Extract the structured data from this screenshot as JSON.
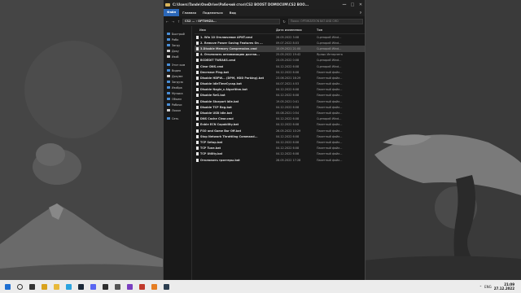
{
  "window": {
    "title": "C:\\Users\\Tande\\OneDrive\\Рабочий стол\\CS2 BOOST DOMOCUM\\CS2 BOO...",
    "controls": [
      "—",
      "□",
      "✕"
    ]
  },
  "menu": [
    "Файл",
    "Главная",
    "Поделиться",
    "Вид"
  ],
  "address": {
    "path": "CS2 ... › OPTIMIZA...",
    "search_placeholder": "Поиск: OPTIMIZATION BAT AND CMD"
  },
  "sidebar": [
    {
      "label": "Быстрый",
      "icon": "star-icon",
      "color": "#4a8fd8"
    },
    {
      "label": "Рабо",
      "icon": "desktop-icon",
      "color": "#4a8fd8"
    },
    {
      "label": "Загру",
      "icon": "download-icon",
      "color": "#4a8fd8"
    },
    {
      "label": "Доку",
      "icon": "document-icon",
      "color": "#cfcfcf"
    },
    {
      "label": "Изоб",
      "icon": "pictures-icon",
      "color": "#cfcfcf"
    },
    {
      "label": "Этот ком",
      "icon": "computer-icon",
      "color": "#4a8fd8"
    },
    {
      "label": "Видео",
      "icon": "video-icon",
      "color": "#4a8fd8"
    },
    {
      "label": "Докуме",
      "icon": "document-icon",
      "color": "#cfcfcf"
    },
    {
      "label": "Загрузк",
      "icon": "download-icon",
      "color": "#4a8fd8"
    },
    {
      "label": "Изобра",
      "icon": "pictures-icon",
      "color": "#4a8fd8"
    },
    {
      "label": "Музыка",
      "icon": "music-icon",
      "color": "#4a8fd8"
    },
    {
      "label": "Объем",
      "icon": "objects-icon",
      "color": "#4a8fd8"
    },
    {
      "label": "Рабочи",
      "icon": "desktop-icon",
      "color": "#4a8fd8"
    },
    {
      "label": "Локал",
      "icon": "drive-icon",
      "color": "#cfcfcf"
    },
    {
      "label": "Сеть",
      "icon": "network-icon",
      "color": "#4a8fd8"
    }
  ],
  "columns": {
    "name": "Имя",
    "date": "Дата изменения",
    "type": "Тип"
  },
  "files": [
    {
      "name": "1. Win 10 Отключение APNT.cmd",
      "date": "26.05.2022 3:08",
      "type": "Сценарий Wind..."
    },
    {
      "name": "2. Remove Power Saving Features On ...",
      "date": "09.07.2022 8:03",
      "type": "Сценарий Wind..."
    },
    {
      "name": "3.Disable Memory Compression.cmd",
      "date": "15.09.2021 21:00",
      "type": "Сценарий Wind..."
    },
    {
      "name": "4. Отключить оптимизацию достав...",
      "date": "25.05.2022 19:42",
      "type": "Ярлык Интернета"
    },
    {
      "name": "BCDEDIT TWEAKS.cmd",
      "date": "23.05.2022 0:08",
      "type": "Сценарий Wind..."
    },
    {
      "name": "Clear DNS.cmd",
      "date": "04.12.2022 6:08",
      "type": "Сценарий Wind..."
    },
    {
      "name": "Decrease Ping.bat",
      "date": "04.12.2022 6:08",
      "type": "Пакетный файл..."
    },
    {
      "name": "Disable HDPW... (DPM, HDD Parking).bat",
      "date": "23.06.2021 16:29",
      "type": "Пакетный файл..."
    },
    {
      "name": "Disable IdleTimeCycap.bat",
      "date": "04.07.2021 4:53",
      "type": "Пакетный файл..."
    },
    {
      "name": "Disable Nagle_s Algorithm.bat",
      "date": "04.12.2022 6:08",
      "type": "Пакетный файл..."
    },
    {
      "name": "Disable ReG.bat",
      "date": "04.12.2022 6:08",
      "type": "Пакетный файл..."
    },
    {
      "name": "Disable Storport Idle.bat",
      "date": "19.05.2021 0:41",
      "type": "Пакетный файл..."
    },
    {
      "name": "Disable TCP Reg.bat",
      "date": "04.12.2022 6:08",
      "type": "Пакетный файл..."
    },
    {
      "name": "Disable USB Idle.bat",
      "date": "05.08.2021 0:54",
      "type": "Пакетный файл..."
    },
    {
      "name": "DNS Cache Clear.cmd",
      "date": "04.12.2022 6:08",
      "type": "Сценарий Wind..."
    },
    {
      "name": "Enble ECN Capability.bat",
      "date": "04.12.2022 6:08",
      "type": "Пакетный файл..."
    },
    {
      "name": "FSO and Game Bar Off.bat",
      "date": "26.05.2022 10:29",
      "type": "Пакетный файл..."
    },
    {
      "name": "Stop Network Throttling Command...",
      "date": "04.12.2022 6:08",
      "type": "Пакетный файл..."
    },
    {
      "name": "TCP Setup.bat",
      "date": "04.12.2022 6:08",
      "type": "Пакетный файл..."
    },
    {
      "name": "TCP Tune.bat",
      "date": "04.12.2022 6:08",
      "type": "Пакетный файл..."
    },
    {
      "name": "TCP Utility.bat",
      "date": "04.12.2022 6:08",
      "type": "Пакетный файл..."
    },
    {
      "name": "Отключить триггеры.bat",
      "date": "28.05.2022 17:28",
      "type": "Пакетный файл..."
    }
  ],
  "selected_index": 2,
  "taskbar": {
    "icons": [
      {
        "name": "windows-start-icon",
        "color": "#1f6fd1"
      },
      {
        "name": "search-icon",
        "color": "#333333"
      },
      {
        "name": "task-view-icon",
        "color": "#333333"
      },
      {
        "name": "chrome-icon",
        "color": "#d9a21b"
      },
      {
        "name": "file-explorer-icon",
        "color": "#e8b93a"
      },
      {
        "name": "telegram-icon",
        "color": "#2aa3df"
      },
      {
        "name": "steam-icon",
        "color": "#1b2838"
      },
      {
        "name": "discord-icon",
        "color": "#5865f2"
      },
      {
        "name": "obs-icon",
        "color": "#303030"
      },
      {
        "name": "settings-icon",
        "color": "#555555"
      },
      {
        "name": "app-icon",
        "color": "#7a3fc0"
      },
      {
        "name": "app2-icon",
        "color": "#c0392b"
      },
      {
        "name": "app3-icon",
        "color": "#e67e22"
      },
      {
        "name": "app4-icon",
        "color": "#2c3e50"
      }
    ],
    "lang": "ENG",
    "time": "21:09",
    "date": "27.12.2022"
  }
}
